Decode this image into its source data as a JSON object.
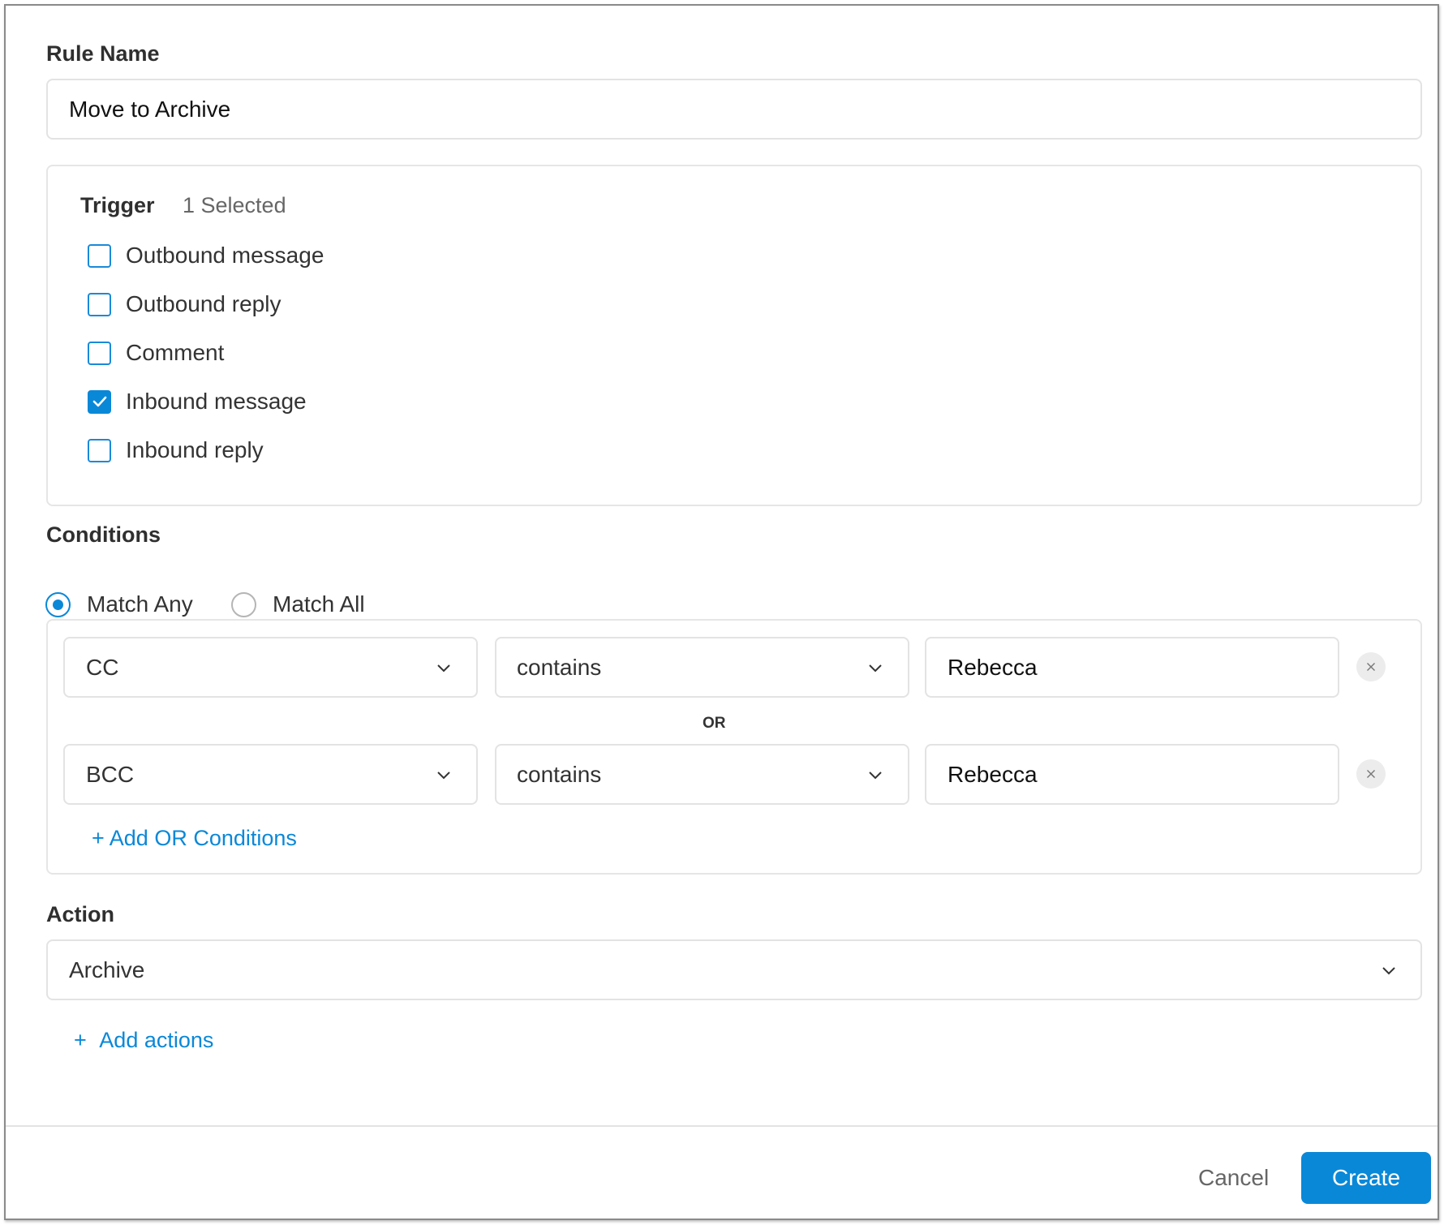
{
  "rule_name": {
    "label": "Rule Name",
    "value": "Move to Archive"
  },
  "trigger": {
    "label": "Trigger",
    "selected_count": "1 Selected",
    "options": [
      {
        "label": "Outbound message",
        "checked": false
      },
      {
        "label": "Outbound reply",
        "checked": false
      },
      {
        "label": "Comment",
        "checked": false
      },
      {
        "label": "Inbound message",
        "checked": true
      },
      {
        "label": "Inbound reply",
        "checked": false
      }
    ]
  },
  "conditions": {
    "label": "Conditions",
    "match_options": [
      {
        "label": "Match Any",
        "selected": true
      },
      {
        "label": "Match All",
        "selected": false
      }
    ],
    "rows": [
      {
        "field": "CC",
        "operator": "contains",
        "value": "Rebecca",
        "remove_icon": "close-icon"
      },
      {
        "field": "BCC",
        "operator": "contains",
        "value": "Rebecca",
        "remove_icon": "close-icon"
      }
    ],
    "joiner": "OR",
    "add_link": "+ Add OR Conditions"
  },
  "action": {
    "label": "Action",
    "selected": "Archive",
    "add_link_icon": "+",
    "add_link": "Add actions"
  },
  "footer": {
    "cancel_label": "Cancel",
    "create_label": "Create"
  },
  "colors": {
    "accent": "#0a88d8",
    "border": "#e3e3e3",
    "text": "#333333"
  }
}
